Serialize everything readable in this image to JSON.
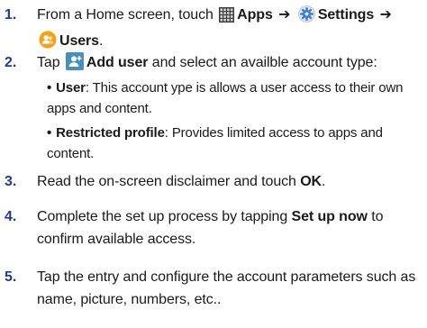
{
  "steps": [
    {
      "number": "1.",
      "parts": {
        "a": "From a Home screen, touch",
        "apps": "Apps",
        "arrow1": "➔",
        "settings": "Settings",
        "arrow2": "➔",
        "users": "Users",
        "end": "."
      }
    },
    {
      "number": "2.",
      "parts": {
        "a": "Tap",
        "add_user": "Add user",
        "b": "and select an availble account type:"
      },
      "bullets": [
        {
          "term": "User",
          "text": ": This account ype is allows a user access to their own apps and content."
        },
        {
          "term": "Restricted profile",
          "text": ": Provides limited access to apps and content."
        }
      ]
    },
    {
      "number": "3.",
      "parts": {
        "a": "Read the on-screen disclaimer and touch",
        "ok": "OK",
        "end": "."
      }
    },
    {
      "number": "4.",
      "parts": {
        "a": "Complete the set up process by tapping",
        "setup": "Set up now",
        "b": "to confirm available access."
      }
    },
    {
      "number": "5.",
      "parts": {
        "a": "Tap the entry and configure the account parameters such as name, picture, numbers, etc.."
      }
    }
  ],
  "bullet_symbol": "•",
  "icons": {
    "apps": "apps-grid-icon",
    "settings": "settings-gear-icon",
    "users": "users-icon",
    "add_user": "add-user-icon"
  },
  "colors": {
    "step_number": "#1f3d8a",
    "text": "#1a1a1a",
    "users_icon": "#f0a31c",
    "add_user_icon": "#4a8fb8",
    "settings_icon": "#3a7bd5",
    "apps_icon": "#555555"
  }
}
